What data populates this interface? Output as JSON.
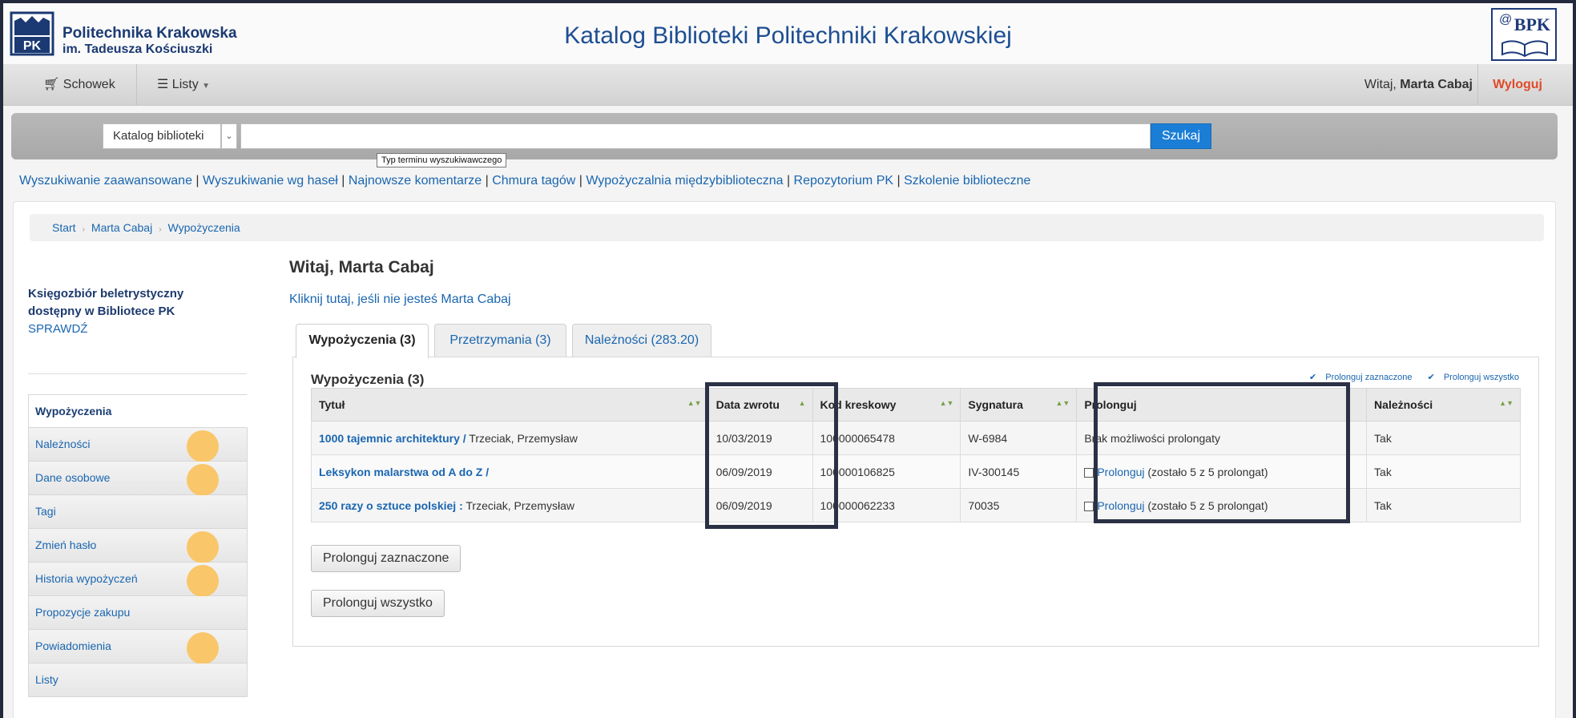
{
  "header": {
    "org_line1": "Politechnika Krakowska",
    "org_line2": "im. Tadeusza Kościuszki",
    "crest_text": "PK",
    "site_title": "Katalog Biblioteki Politechniki Krakowskiej",
    "bpk_logo": "BPK",
    "bpk_at": "@"
  },
  "navbar": {
    "cart_label": "Schowek",
    "lists_label": "Listy",
    "welcome_prefix": "Witaj, ",
    "welcome_name": "Marta Cabaj",
    "logout_label": "Wyloguj"
  },
  "search": {
    "scope_value": "Katalog biblioteki",
    "button_label": "Szukaj",
    "tooltip": "Typ terminu wyszukiwawczego"
  },
  "links": [
    "Wyszukiwanie zaawansowane",
    "Wyszukiwanie wg haseł",
    "Najnowsze komentarze",
    "Chmura tagów",
    "Wypożyczalnia międzybiblioteczna",
    "Repozytorium PK",
    "Szkolenie biblioteczne"
  ],
  "links_separator": " | ",
  "breadcrumb": [
    "Start",
    "Marta Cabaj",
    "Wypożyczenia"
  ],
  "breadcrumb_sep": "›",
  "sidebar": {
    "promo_title": "Księgozbiór beletrystyczny dostępny w Bibliotece PK",
    "promo_link": "SPRAWDŹ",
    "items": [
      {
        "label": "Wypożyczenia"
      },
      {
        "label": "Należności"
      },
      {
        "label": "Dane osobowe"
      },
      {
        "label": "Tagi"
      },
      {
        "label": "Zmień hasło"
      },
      {
        "label": "Historia wypożyczeń"
      },
      {
        "label": "Propozycje zakupu"
      },
      {
        "label": "Powiadomienia"
      },
      {
        "label": "Listy"
      }
    ]
  },
  "content": {
    "title": "Witaj, Marta Cabaj",
    "subtitle": "Kliknij tutaj, jeśli nie jesteś Marta Cabaj",
    "tabs": [
      {
        "label": "Wypożyczenia (3)"
      },
      {
        "label": "Przetrzymania (3)"
      },
      {
        "label": "Należności (283.20)"
      }
    ],
    "table_title": "Wypożyczenia (3)",
    "renew_selected_link": "Prolonguj zaznaczone",
    "renew_all_link": "Prolonguj wszystko",
    "columns": [
      "Tytuł",
      "Data zwrotu",
      "Kod kreskowy",
      "Sygnatura",
      "Prolonguj",
      "Należności"
    ],
    "rows": [
      {
        "title": "1000 tajemnic architektury /",
        "author": "Trzeciak, Przemysław",
        "due": "10/03/2019",
        "barcode": "100000065478",
        "callno": "W-6984",
        "renew_link": "",
        "renew_text": "Brak możliwości prolongaty",
        "fines": "Tak"
      },
      {
        "title": "Leksykon malarstwa od A do Z /",
        "author": "",
        "due": "06/09/2019",
        "barcode": "100000106825",
        "callno": "IV-300145",
        "renew_link": "Prolonguj",
        "renew_text": " (zostało 5 z 5 prolongat)",
        "fines": "Tak"
      },
      {
        "title": "250 razy o sztuce polskiej :",
        "author": "Trzeciak, Przemysław",
        "due": "06/09/2019",
        "barcode": "100000062233",
        "callno": "70035",
        "renew_link": "Prolonguj",
        "renew_text": " (zostało 5 z 5 prolongat)",
        "fines": "Tak"
      }
    ],
    "btn_renew_selected": "Prolonguj zaznaczone",
    "btn_renew_all": "Prolonguj wszystko"
  },
  "colors": {
    "link": "#1a66b0",
    "due_date": "#e04a2b",
    "logout": "#e04a2b",
    "search_button": "#1b7ed6",
    "highlight_box": "#2b3145",
    "marker_dot": "#f9c66a"
  }
}
